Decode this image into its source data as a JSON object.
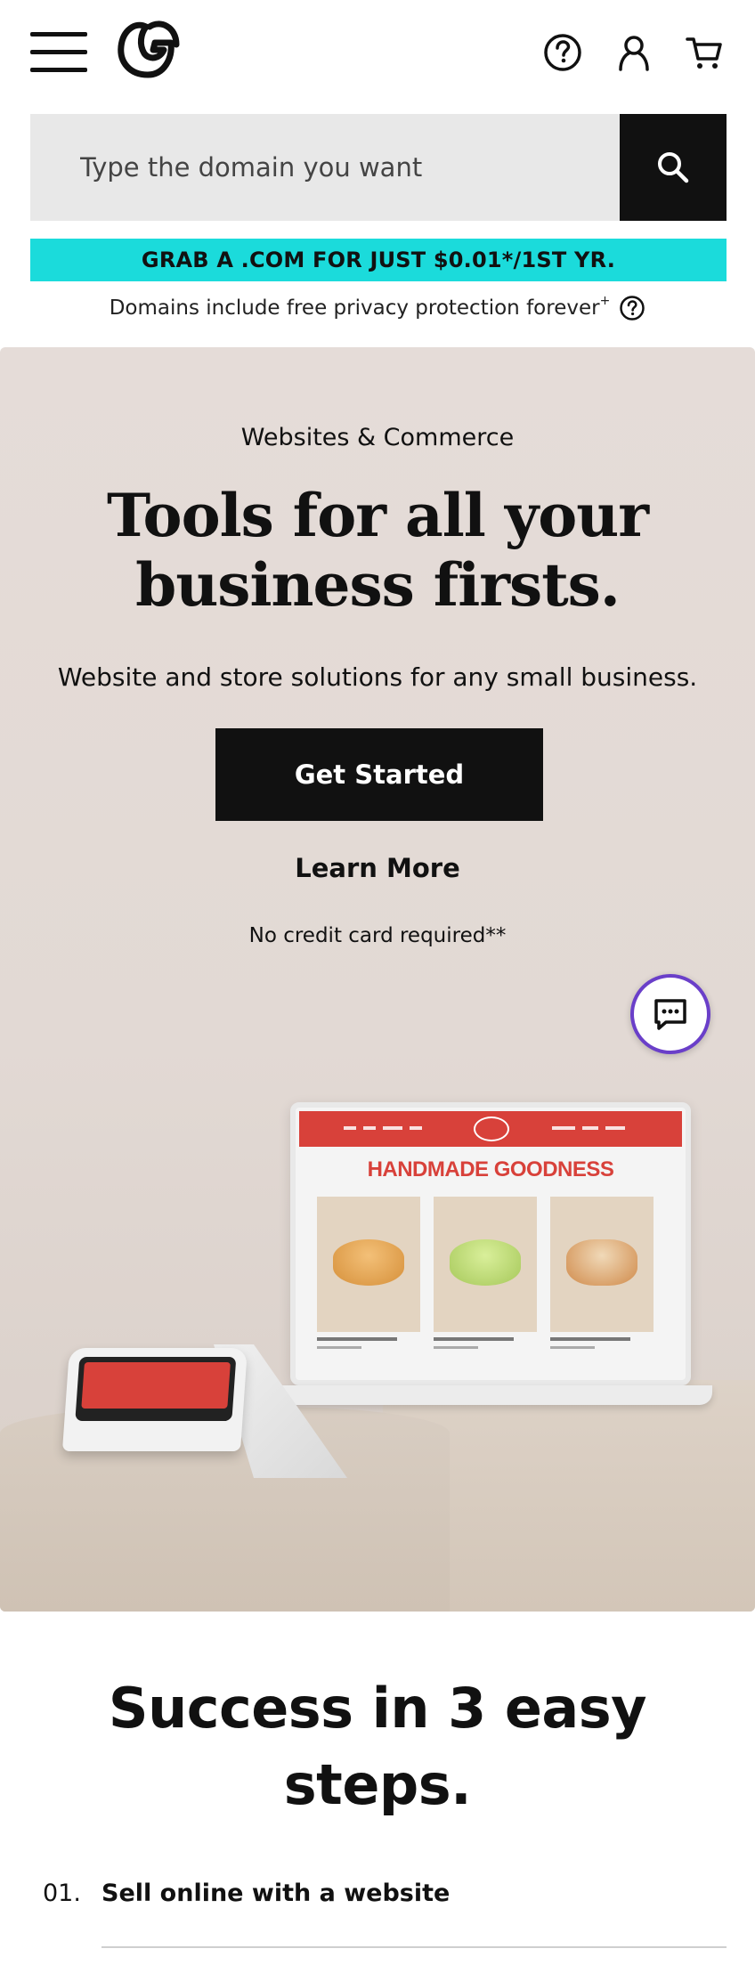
{
  "header": {
    "icons": [
      "menu-icon",
      "godaddy-logo-icon",
      "help-icon",
      "account-icon",
      "cart-icon"
    ]
  },
  "search": {
    "placeholder": "Type the domain you want"
  },
  "promo": {
    "banner": "GRAB A .COM FOR JUST $0.01*/1ST YR.",
    "privacy_text": "Domains include free privacy protection forever",
    "privacy_sup": "+"
  },
  "hero": {
    "eyebrow": "Websites & Commerce",
    "title_line1": "Tools for all your",
    "title_line2": "business firsts.",
    "subtitle": "Website and store solutions for any small business.",
    "primary_cta": "Get Started",
    "secondary_cta": "Learn More",
    "note": "No credit card required**",
    "mock_site_headline": "HANDMADE GOODNESS"
  },
  "steps": {
    "title_line1": "Success in 3 easy",
    "title_line2": "steps.",
    "items": [
      {
        "number": "01.",
        "label": "Sell online with a website"
      }
    ]
  },
  "colors": {
    "promo_bg": "#1bdbdb",
    "hero_bg": "#e5dcd8",
    "cta_bg": "#111111",
    "chat_ring": "#6a3fc9",
    "mock_brand_red": "#d8413a"
  }
}
